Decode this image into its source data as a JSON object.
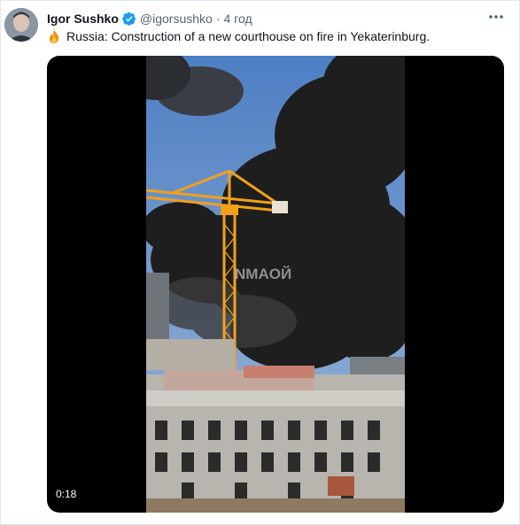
{
  "tweet": {
    "author_name": "Igor Sushko",
    "handle": "@igorsushko",
    "separator": "·",
    "time": "4 год",
    "text": "Russia: Construction of a new courthouse on fire in Yekaterinburg.",
    "verified_color": "#1d9bf0"
  },
  "video": {
    "timestamp": "0:18",
    "watermark": "NMAOЙ"
  },
  "icons": [
    "avatar",
    "verified-badge-icon",
    "fire-emoji-icon",
    "more-options-icon"
  ]
}
